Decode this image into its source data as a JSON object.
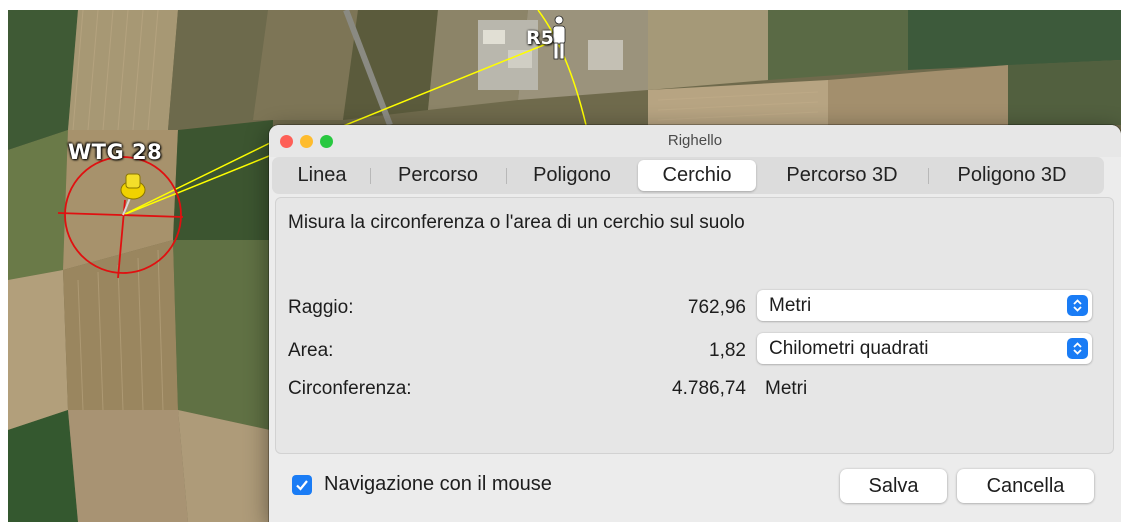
{
  "map": {
    "markers": [
      {
        "label": "WTG 28"
      },
      {
        "label": "R5"
      }
    ]
  },
  "window": {
    "title": "Righello"
  },
  "tabs": [
    {
      "label": "Linea",
      "active": false
    },
    {
      "label": "Percorso",
      "active": false
    },
    {
      "label": "Poligono",
      "active": false
    },
    {
      "label": "Cerchio",
      "active": true
    },
    {
      "label": "Percorso 3D",
      "active": false
    },
    {
      "label": "Poligono 3D",
      "active": false
    }
  ],
  "panel": {
    "description": "Misura la circonferenza o l'area di un cerchio sul suolo",
    "radius": {
      "label": "Raggio:",
      "value": "762,96",
      "unit": "Metri"
    },
    "area": {
      "label": "Area:",
      "value": "1,82",
      "unit": "Chilometri quadrati"
    },
    "circumference": {
      "label": "Circonferenza:",
      "value": "4.786,74",
      "unit": "Metri"
    }
  },
  "footer": {
    "mouse_nav_label": "Navigazione con il mouse",
    "mouse_nav_checked": true,
    "save_label": "Salva",
    "cancel_label": "Cancella"
  },
  "colors": {
    "accent": "#1a7cf5",
    "measure_line": "#ffff00",
    "circle": "#e01010"
  }
}
